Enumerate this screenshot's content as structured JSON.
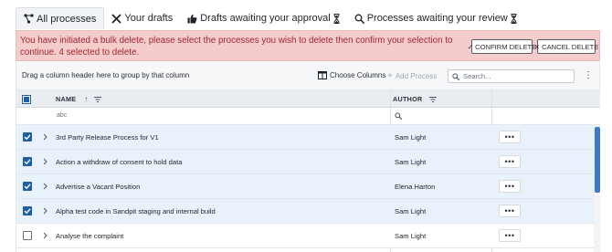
{
  "tabs": [
    {
      "label": "All processes",
      "icon": "flow-icon",
      "active": true
    },
    {
      "label": "Your drafts",
      "icon": "tools-icon",
      "active": false
    },
    {
      "label": "Drafts awaiting your approval",
      "icon": "thumbs-up-icon",
      "trailing_icon": "hourglass-icon",
      "active": false
    },
    {
      "label": "Processes awaiting your review",
      "icon": "search-icon",
      "trailing_icon": "hourglass-icon",
      "active": false
    }
  ],
  "banner": {
    "message": "You have initiated a bulk delete, please select the processes you wish to delete then confirm your selection to continue. 4 selected to delete.",
    "confirm_label": "CONFIRM DELETE",
    "cancel_label": "CANCEL DELETE",
    "color": "#f4cccc",
    "text_color": "#a3262e"
  },
  "toolbar": {
    "group_hint": "Drag a column header here to group by that column",
    "choose_columns_label": "Choose Columns",
    "add_process_label": "Add Process",
    "search_placeholder": "Search..."
  },
  "grid": {
    "columns": [
      {
        "label": "NAME",
        "sort": "ascending",
        "filterable": true
      },
      {
        "label": "AUTHOR",
        "filterable": true
      }
    ],
    "name_filter_hint": "abc",
    "rows": [
      {
        "name": "3rd Party Release Process for V1",
        "author": "Sam Light",
        "selected": true
      },
      {
        "name": "Action a withdraw of consent to hold data",
        "author": "Sam Light",
        "selected": true
      },
      {
        "name": "Advertise a Vacant Position",
        "author": "Elena Harton",
        "selected": true
      },
      {
        "name": "Alpha test code in Sandpit staging and internal build",
        "author": "Sam Light",
        "selected": true
      },
      {
        "name": "Analyse the complaint",
        "author": "Sam Light",
        "selected": false
      }
    ],
    "accent_color": "#1d5fa3"
  }
}
